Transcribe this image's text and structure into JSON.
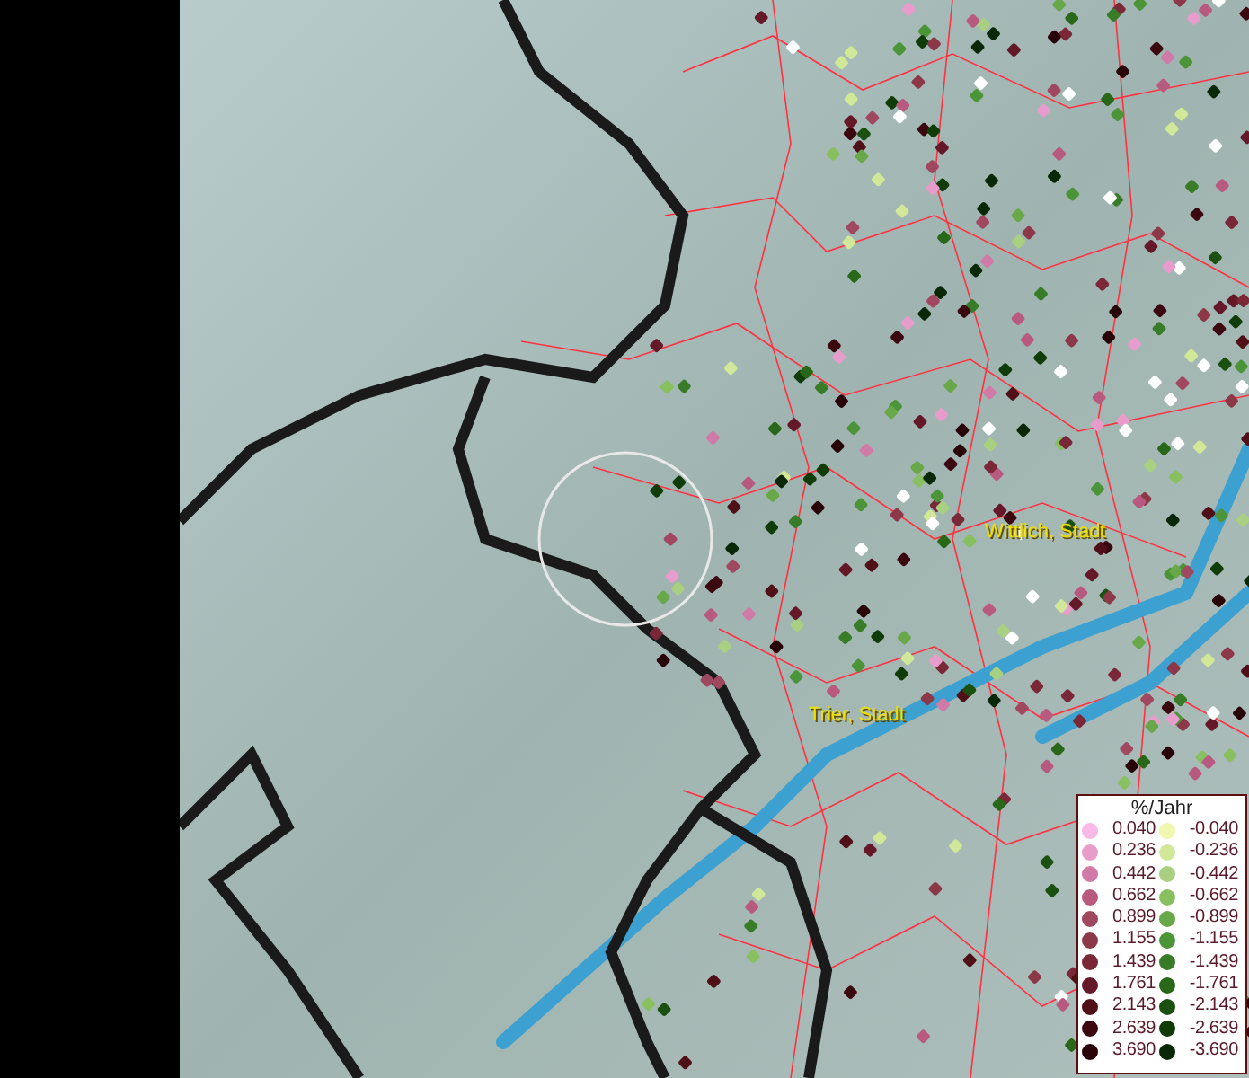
{
  "map": {
    "places": [
      {
        "name": "Wittlich, Stadt"
      },
      {
        "name": "Trier, Stadt"
      }
    ]
  },
  "legend": {
    "title": "%/Jahr",
    "rows": [
      {
        "positive": {
          "value": "0.040",
          "color": "#f8b8e8"
        },
        "negative": {
          "value": "-0.040",
          "color": "#f0f8b0"
        }
      },
      {
        "positive": {
          "value": "0.236",
          "color": "#e89ccc"
        },
        "negative": {
          "value": "-0.236",
          "color": "#d0e898"
        }
      },
      {
        "positive": {
          "value": "0.442",
          "color": "#d07aa8"
        },
        "negative": {
          "value": "-0.442",
          "color": "#a8d080"
        }
      },
      {
        "positive": {
          "value": "0.662",
          "color": "#b85a80"
        },
        "negative": {
          "value": "-0.662",
          "color": "#88c060"
        }
      },
      {
        "positive": {
          "value": "0.899",
          "color": "#a04860"
        },
        "negative": {
          "value": "-0.899",
          "color": "#68a848"
        }
      },
      {
        "positive": {
          "value": "1.155",
          "color": "#8c3848"
        },
        "negative": {
          "value": "-1.155",
          "color": "#4c9438"
        }
      },
      {
        "positive": {
          "value": "1.439",
          "color": "#7a2838"
        },
        "negative": {
          "value": "-1.439",
          "color": "#387c28"
        }
      },
      {
        "positive": {
          "value": "1.761",
          "color": "#641828"
        },
        "negative": {
          "value": "-1.761",
          "color": "#286818"
        }
      },
      {
        "positive": {
          "value": "2.143",
          "color": "#501018"
        },
        "negative": {
          "value": "-2.143",
          "color": "#1c5010"
        }
      },
      {
        "positive": {
          "value": "2.639",
          "color": "#3c0810"
        },
        "negative": {
          "value": "-2.639",
          "color": "#103c08"
        }
      },
      {
        "positive": {
          "value": "3.690",
          "color": "#280408"
        },
        "negative": {
          "value": "-3.690",
          "color": "#082808"
        }
      }
    ]
  }
}
